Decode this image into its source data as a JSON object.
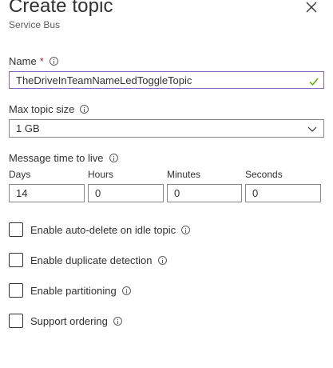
{
  "header": {
    "title": "Create topic",
    "subtitle": "Service Bus"
  },
  "name_field": {
    "label": "Name",
    "required_marker": "*",
    "value": "TheDriveInTeamNameLedToggleTopic",
    "validation_icon": "check-icon"
  },
  "max_topic_size": {
    "label": "Max topic size",
    "selected": "1 GB"
  },
  "message_ttl": {
    "label": "Message time to live",
    "fields": [
      {
        "label": "Days",
        "value": "14"
      },
      {
        "label": "Hours",
        "value": "0"
      },
      {
        "label": "Minutes",
        "value": "0"
      },
      {
        "label": "Seconds",
        "value": "0"
      }
    ]
  },
  "options": [
    {
      "label": "Enable auto-delete on idle topic",
      "checked": false
    },
    {
      "label": "Enable duplicate detection",
      "checked": false
    },
    {
      "label": "Enable partitioning",
      "checked": false
    },
    {
      "label": "Support ordering",
      "checked": false
    }
  ],
  "colors": {
    "accent_focus": "#8764b8",
    "valid_check": "#57a300",
    "required": "#a4262c"
  }
}
